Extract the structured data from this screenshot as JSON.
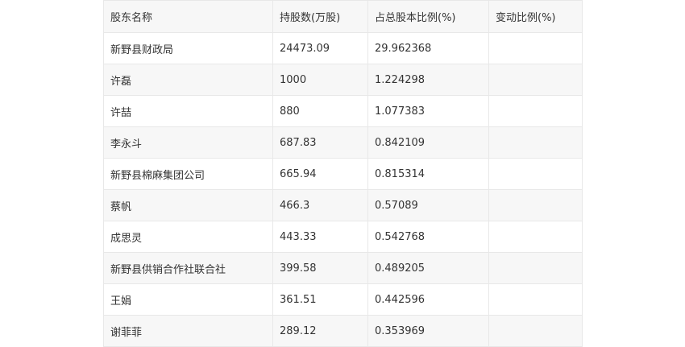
{
  "table": {
    "headers": [
      "股东名称",
      "持股数(万股)",
      "占总股本比例(%)",
      "变动比例(%)"
    ],
    "rows": [
      [
        "新野县财政局",
        "24473.09",
        "29.962368",
        ""
      ],
      [
        "许磊",
        "1000",
        "1.224298",
        ""
      ],
      [
        "许喆",
        "880",
        "1.077383",
        ""
      ],
      [
        "李永斗",
        "687.83",
        "0.842109",
        ""
      ],
      [
        "新野县棉麻集团公司",
        "665.94",
        "0.815314",
        ""
      ],
      [
        "蔡帆",
        "466.3",
        "0.57089",
        ""
      ],
      [
        "成思灵",
        "443.33",
        "0.542768",
        ""
      ],
      [
        "新野县供销合作社联合社",
        "399.58",
        "0.489205",
        ""
      ],
      [
        "王娟",
        "361.51",
        "0.442596",
        ""
      ],
      [
        "谢菲菲",
        "289.12",
        "0.353969",
        ""
      ]
    ]
  }
}
